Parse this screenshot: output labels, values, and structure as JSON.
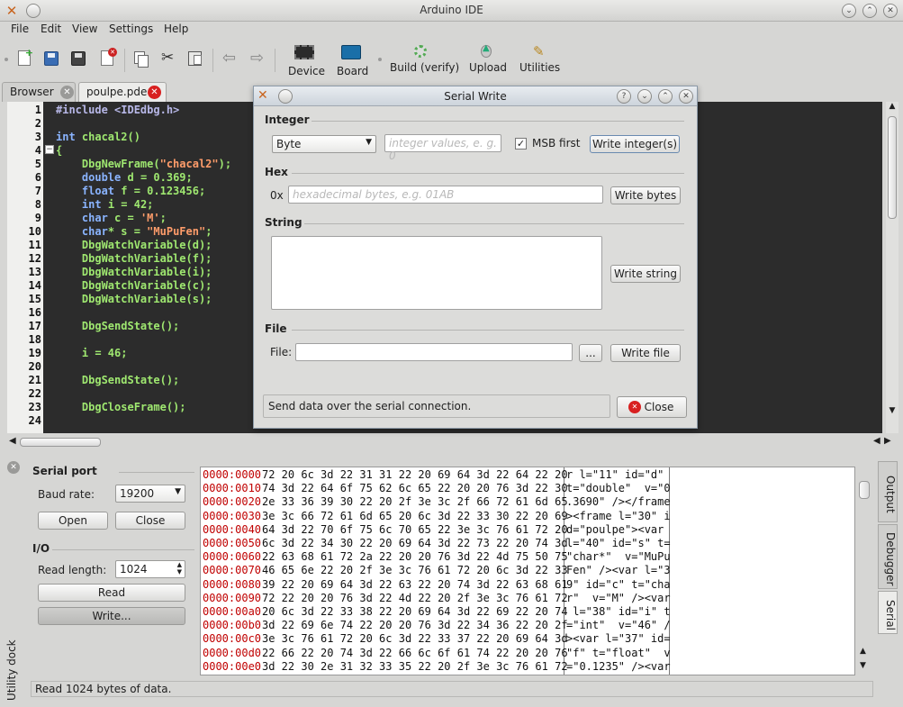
{
  "window": {
    "title": "Arduino IDE"
  },
  "menu": [
    {
      "label": "File"
    },
    {
      "label": "Edit"
    },
    {
      "label": "View"
    },
    {
      "label": "Settings"
    },
    {
      "label": "Help"
    }
  ],
  "toolbar": {
    "device": "Device",
    "board": "Board",
    "build": "Build (verify)",
    "upload": "Upload",
    "utilities": "Utilities"
  },
  "tabs": [
    {
      "label": "Browser"
    },
    {
      "label": "poulpe.pde"
    }
  ],
  "editor": {
    "line_numbers": [
      "1",
      "2",
      "3",
      "4",
      "5",
      "6",
      "7",
      "8",
      "9",
      "10",
      "11",
      "12",
      "13",
      "14",
      "15",
      "16",
      "17",
      "18",
      "19",
      "20",
      "21",
      "22",
      "23",
      "24"
    ],
    "lines": [
      "#include <IDEdbg.h>",
      "",
      "int chacal2()",
      "{",
      "    DbgNewFrame(\"chacal2\");",
      "    double d = 0.369;",
      "    float f = 0.123456;",
      "    int i = 42;",
      "    char c = 'M';",
      "    char* s = \"MuPuFen\";",
      "    DbgWatchVariable(d);",
      "    DbgWatchVariable(f);",
      "    DbgWatchVariable(i);",
      "    DbgWatchVariable(c);",
      "    DbgWatchVariable(s);",
      "",
      "    DbgSendState();",
      "",
      "    i = 46;",
      "",
      "    DbgSendState();",
      "",
      "    DbgCloseFrame();",
      ""
    ]
  },
  "serial_panel": {
    "group_serial": "Serial port",
    "baud_label": "Baud rate:",
    "baud_value": "19200",
    "open": "Open",
    "close": "Close",
    "group_io": "I/O",
    "read_length_label": "Read length:",
    "read_length_value": "1024",
    "read": "Read",
    "write": "Write..."
  },
  "hex": [
    {
      "off": "0000:0000",
      "hex": "72 20 6c 3d 22 31 31 22 20 69 64 3d 22 64 22 20",
      "asc": "r l=\"11\" id=\"d\" "
    },
    {
      "off": "0000:0010",
      "hex": "74 3d 22 64 6f 75 62 6c 65 22 20 20 76 3d 22 30",
      "asc": "t=\"double\"  v=\"0"
    },
    {
      "off": "0000:0020",
      "hex": "2e 33 36 39 30 22 20 2f 3e 3c 2f 66 72 61 6d 65",
      "asc": ".3690\" /></frame"
    },
    {
      "off": "0000:0030",
      "hex": "3e 3c 66 72 61 6d 65 20 6c 3d 22 33 30 22 20 69",
      "asc": "><frame l=\"30\" i"
    },
    {
      "off": "0000:0040",
      "hex": "64 3d 22 70 6f 75 6c 70 65 22 3e 3c 76 61 72 20",
      "asc": "d=\"poulpe\"><var "
    },
    {
      "off": "0000:0050",
      "hex": "6c 3d 22 34 30 22 20 69 64 3d 22 73 22 20 74 3d",
      "asc": "l=\"40\" id=\"s\" t="
    },
    {
      "off": "0000:0060",
      "hex": "22 63 68 61 72 2a 22 20 20 76 3d 22 4d 75 50 75",
      "asc": "\"char*\"  v=\"MuPu"
    },
    {
      "off": "0000:0070",
      "hex": "46 65 6e 22 20 2f 3e 3c 76 61 72 20 6c 3d 22 33",
      "asc": "Fen\" /><var l=\"3"
    },
    {
      "off": "0000:0080",
      "hex": "39 22 20 69 64 3d 22 63 22 20 74 3d 22 63 68 61",
      "asc": "9\" id=\"c\" t=\"cha"
    },
    {
      "off": "0000:0090",
      "hex": "72 22 20 20 76 3d 22 4d 22 20 2f 3e 3c 76 61 72",
      "asc": "r\"  v=\"M\" /><var"
    },
    {
      "off": "0000:00a0",
      "hex": "20 6c 3d 22 33 38 22 20 69 64 3d 22 69 22 20 74",
      "asc": " l=\"38\" id=\"i\" t"
    },
    {
      "off": "0000:00b0",
      "hex": "3d 22 69 6e 74 22 20 20 76 3d 22 34 36 22 20 2f",
      "asc": "=\"int\"  v=\"46\" /"
    },
    {
      "off": "0000:00c0",
      "hex": "3e 3c 76 61 72 20 6c 3d 22 33 37 22 20 69 64 3d",
      "asc": "><var l=\"37\" id="
    },
    {
      "off": "0000:00d0",
      "hex": "22 66 22 20 74 3d 22 66 6c 6f 61 74 22 20 20 76",
      "asc": "\"f\" t=\"float\"  v"
    },
    {
      "off": "0000:00e0",
      "hex": "3d 22 30 2e 31 32 33 35 22 20 2f 3e 3c 76 61 72",
      "asc": "=\"0.1235\" /><var"
    }
  ],
  "status": "Read 1024 bytes of data.",
  "dock": {
    "utility_label": "Utility dock",
    "right_tabs": [
      {
        "label": "Output"
      },
      {
        "label": "Debugger"
      },
      {
        "label": "Serial"
      }
    ]
  },
  "dialog": {
    "title": "Serial Write",
    "integer_group": "Integer",
    "integer_type": "Byte",
    "integer_placeholder": "integer values, e. g. 0",
    "msb_label": "MSB first",
    "write_integer": "Write integer(s)",
    "hex_group": "Hex",
    "hex_prefix": "0x",
    "hex_placeholder": "hexadecimal bytes, e.g. 01AB",
    "write_bytes": "Write bytes",
    "string_group": "String",
    "write_string": "Write string",
    "file_group": "File",
    "file_label": "File:",
    "browse": "...",
    "write_file": "Write file",
    "hint": "Send data over the serial connection.",
    "close": "Close"
  }
}
